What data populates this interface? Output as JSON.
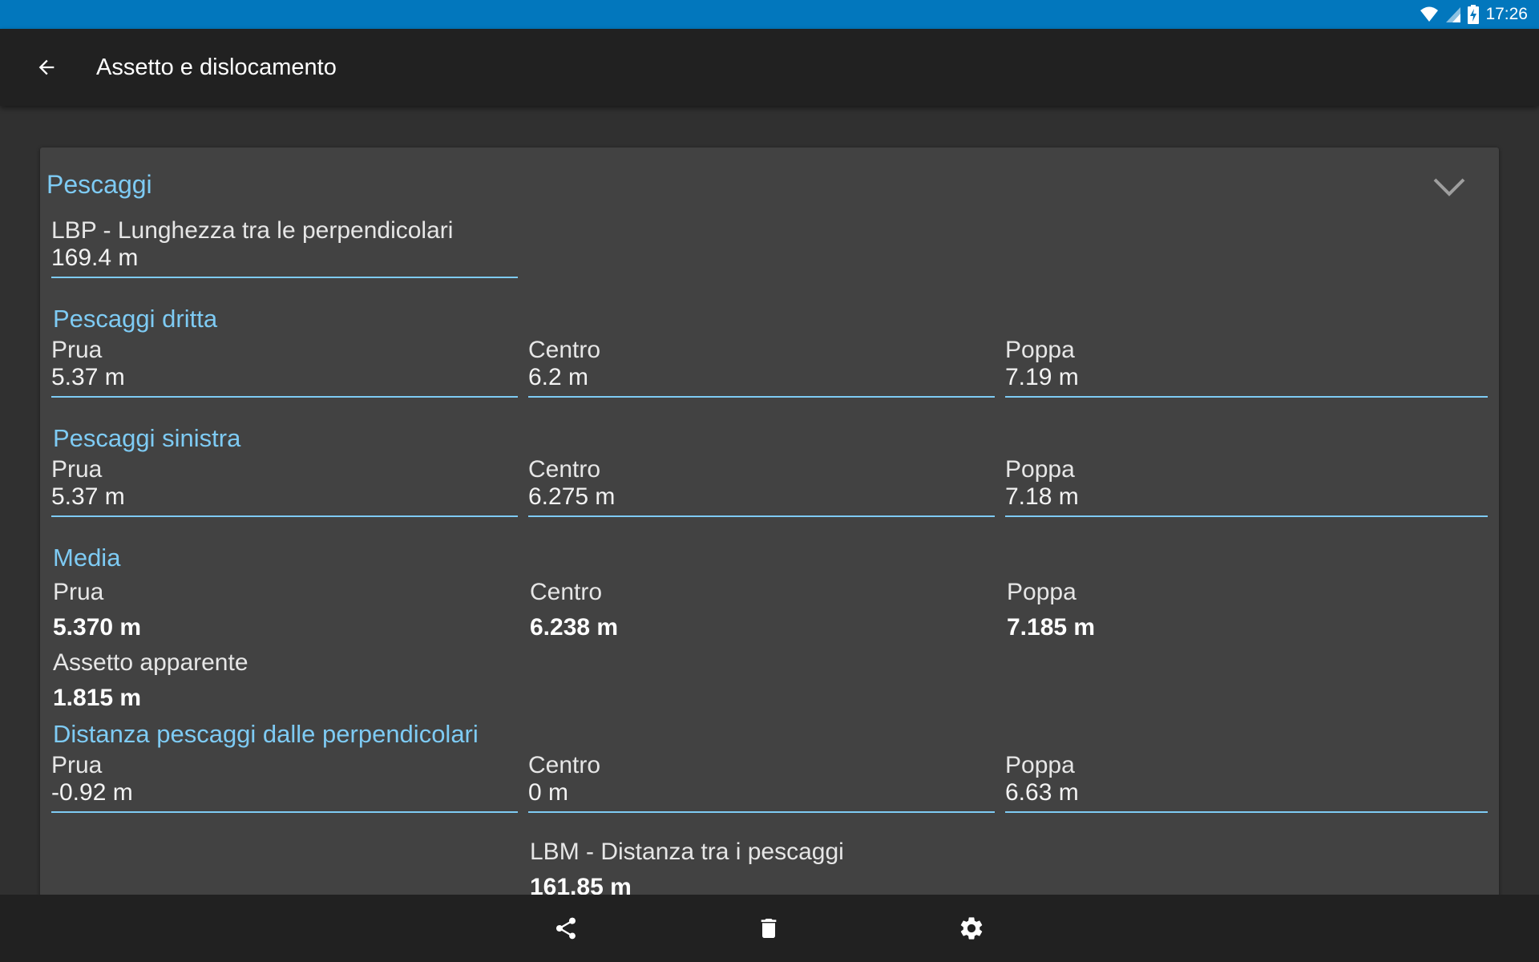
{
  "status": {
    "time": "17:26"
  },
  "header": {
    "title": "Assetto e dislocamento"
  },
  "card": {
    "title": "Pescaggi",
    "lbp": {
      "label": "LBP - Lunghezza tra le perpendicolari",
      "value": "169.4 m"
    },
    "starboard": {
      "title": "Pescaggi dritta",
      "bow": {
        "label": "Prua",
        "value": "5.37 m"
      },
      "mid": {
        "label": "Centro",
        "value": "6.2 m"
      },
      "stern": {
        "label": "Poppa",
        "value": "7.19 m"
      }
    },
    "port": {
      "title": "Pescaggi sinistra",
      "bow": {
        "label": "Prua",
        "value": "5.37 m"
      },
      "mid": {
        "label": "Centro",
        "value": "6.275 m"
      },
      "stern": {
        "label": "Poppa",
        "value": "7.18 m"
      }
    },
    "mean": {
      "title": "Media",
      "bow": {
        "label": "Prua",
        "value": "5.370 m"
      },
      "mid": {
        "label": "Centro",
        "value": "6.238 m"
      },
      "stern": {
        "label": "Poppa",
        "value": "7.185 m"
      },
      "trim": {
        "label": "Assetto apparente",
        "value": "1.815 m"
      }
    },
    "distance": {
      "title": "Distanza pescaggi dalle perpendicolari",
      "bow": {
        "label": "Prua",
        "value": "-0.92 m"
      },
      "mid": {
        "label": "Centro",
        "value": "0 m"
      },
      "stern": {
        "label": "Poppa",
        "value": "6.63 m"
      }
    },
    "lbm": {
      "label": "LBM - Distanza tra i pescaggi",
      "value": "161.85 m"
    }
  },
  "bottombar": {
    "icons": [
      "share-icon",
      "delete-icon",
      "settings-icon"
    ]
  }
}
